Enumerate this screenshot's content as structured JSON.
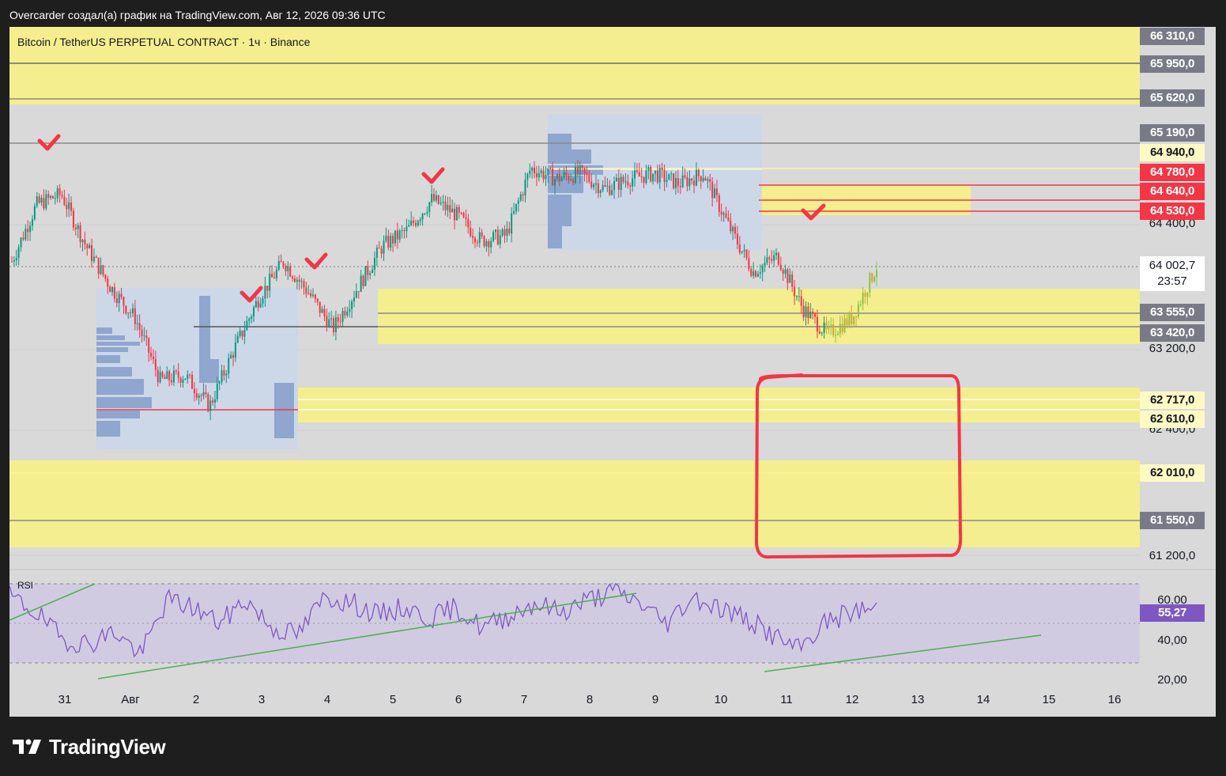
{
  "header": {
    "text": "Overcarder создал(а) график на TradingView.com, Авг 12, 2026 09:36 UTC"
  },
  "symbol": {
    "title": "Bitcoin / TetherUS PERPETUAL CONTRACT · 1ч · Binance"
  },
  "rsi": {
    "label": "RSI",
    "value": "55,27",
    "value_color": "#7e57c2",
    "axis": [
      "60,00",
      "40,00",
      "20,00"
    ]
  },
  "price_axis": {
    "labels": [
      {
        "text": "66 310,0",
        "bg": "#787b86",
        "fg": "#ffffff"
      },
      {
        "text": "65 950,0",
        "bg": "#787b86",
        "fg": "#ffffff"
      },
      {
        "text": "65 620,0",
        "bg": "#787b86",
        "fg": "#ffffff"
      },
      {
        "text": "65 190,0",
        "bg": "#787b86",
        "fg": "#ffffff"
      },
      {
        "text": "64 940,0",
        "bg": "#fff9c4",
        "fg": "#131722"
      },
      {
        "text": "64 780,0",
        "bg": "#f23645",
        "fg": "#ffffff"
      },
      {
        "text": "64 640,0",
        "bg": "#f23645",
        "fg": "#ffffff"
      },
      {
        "text": "64 530,0",
        "bg": "#f23645",
        "fg": "#ffffff"
      },
      {
        "text": "63 555,0",
        "bg": "#787b86",
        "fg": "#ffffff"
      },
      {
        "text": "63 420,0",
        "bg": "#787b86",
        "fg": "#ffffff"
      },
      {
        "text": "62 717,0",
        "bg": "#fff9c4",
        "fg": "#131722"
      },
      {
        "text": "62 610,0",
        "bg": "#fff9c4",
        "fg": "#131722"
      },
      {
        "text": "62 010,0",
        "bg": "#fff9c4",
        "fg": "#131722"
      },
      {
        "text": "61 550,0",
        "bg": "#787b86",
        "fg": "#ffffff"
      }
    ],
    "ticks": [
      "64 400,0",
      "63 200,0",
      "62 400,0",
      "61 200,0"
    ],
    "last_price": "64 002,7",
    "countdown": "23:57"
  },
  "time_axis": [
    "31",
    "Авг",
    "2",
    "3",
    "4",
    "5",
    "6",
    "7",
    "8",
    "9",
    "10",
    "11",
    "12",
    "13",
    "14",
    "15",
    "16"
  ],
  "colors": {
    "up": "#089981",
    "down": "#f23645",
    "zone": "#f4ee8e",
    "profile": "#b2c7e8",
    "rsi_line": "#7e57c2",
    "trend": "#4caf50"
  },
  "brand": {
    "name": "TradingView"
  },
  "chart_data": {
    "type": "candlestick",
    "price_range": [
      61200,
      66310
    ],
    "close_path": [
      64050,
      64600,
      64700,
      64200,
      63800,
      63500,
      62900,
      62950,
      62650,
      63200,
      63700,
      64050,
      63750,
      63400,
      63800,
      64200,
      64350,
      64650,
      64500,
      64250,
      64300,
      64950,
      64850,
      64900,
      64750,
      64850,
      64900,
      64800,
      64900,
      64400,
      63950,
      64100,
      63600,
      63350,
      63500,
      64000
    ]
  }
}
